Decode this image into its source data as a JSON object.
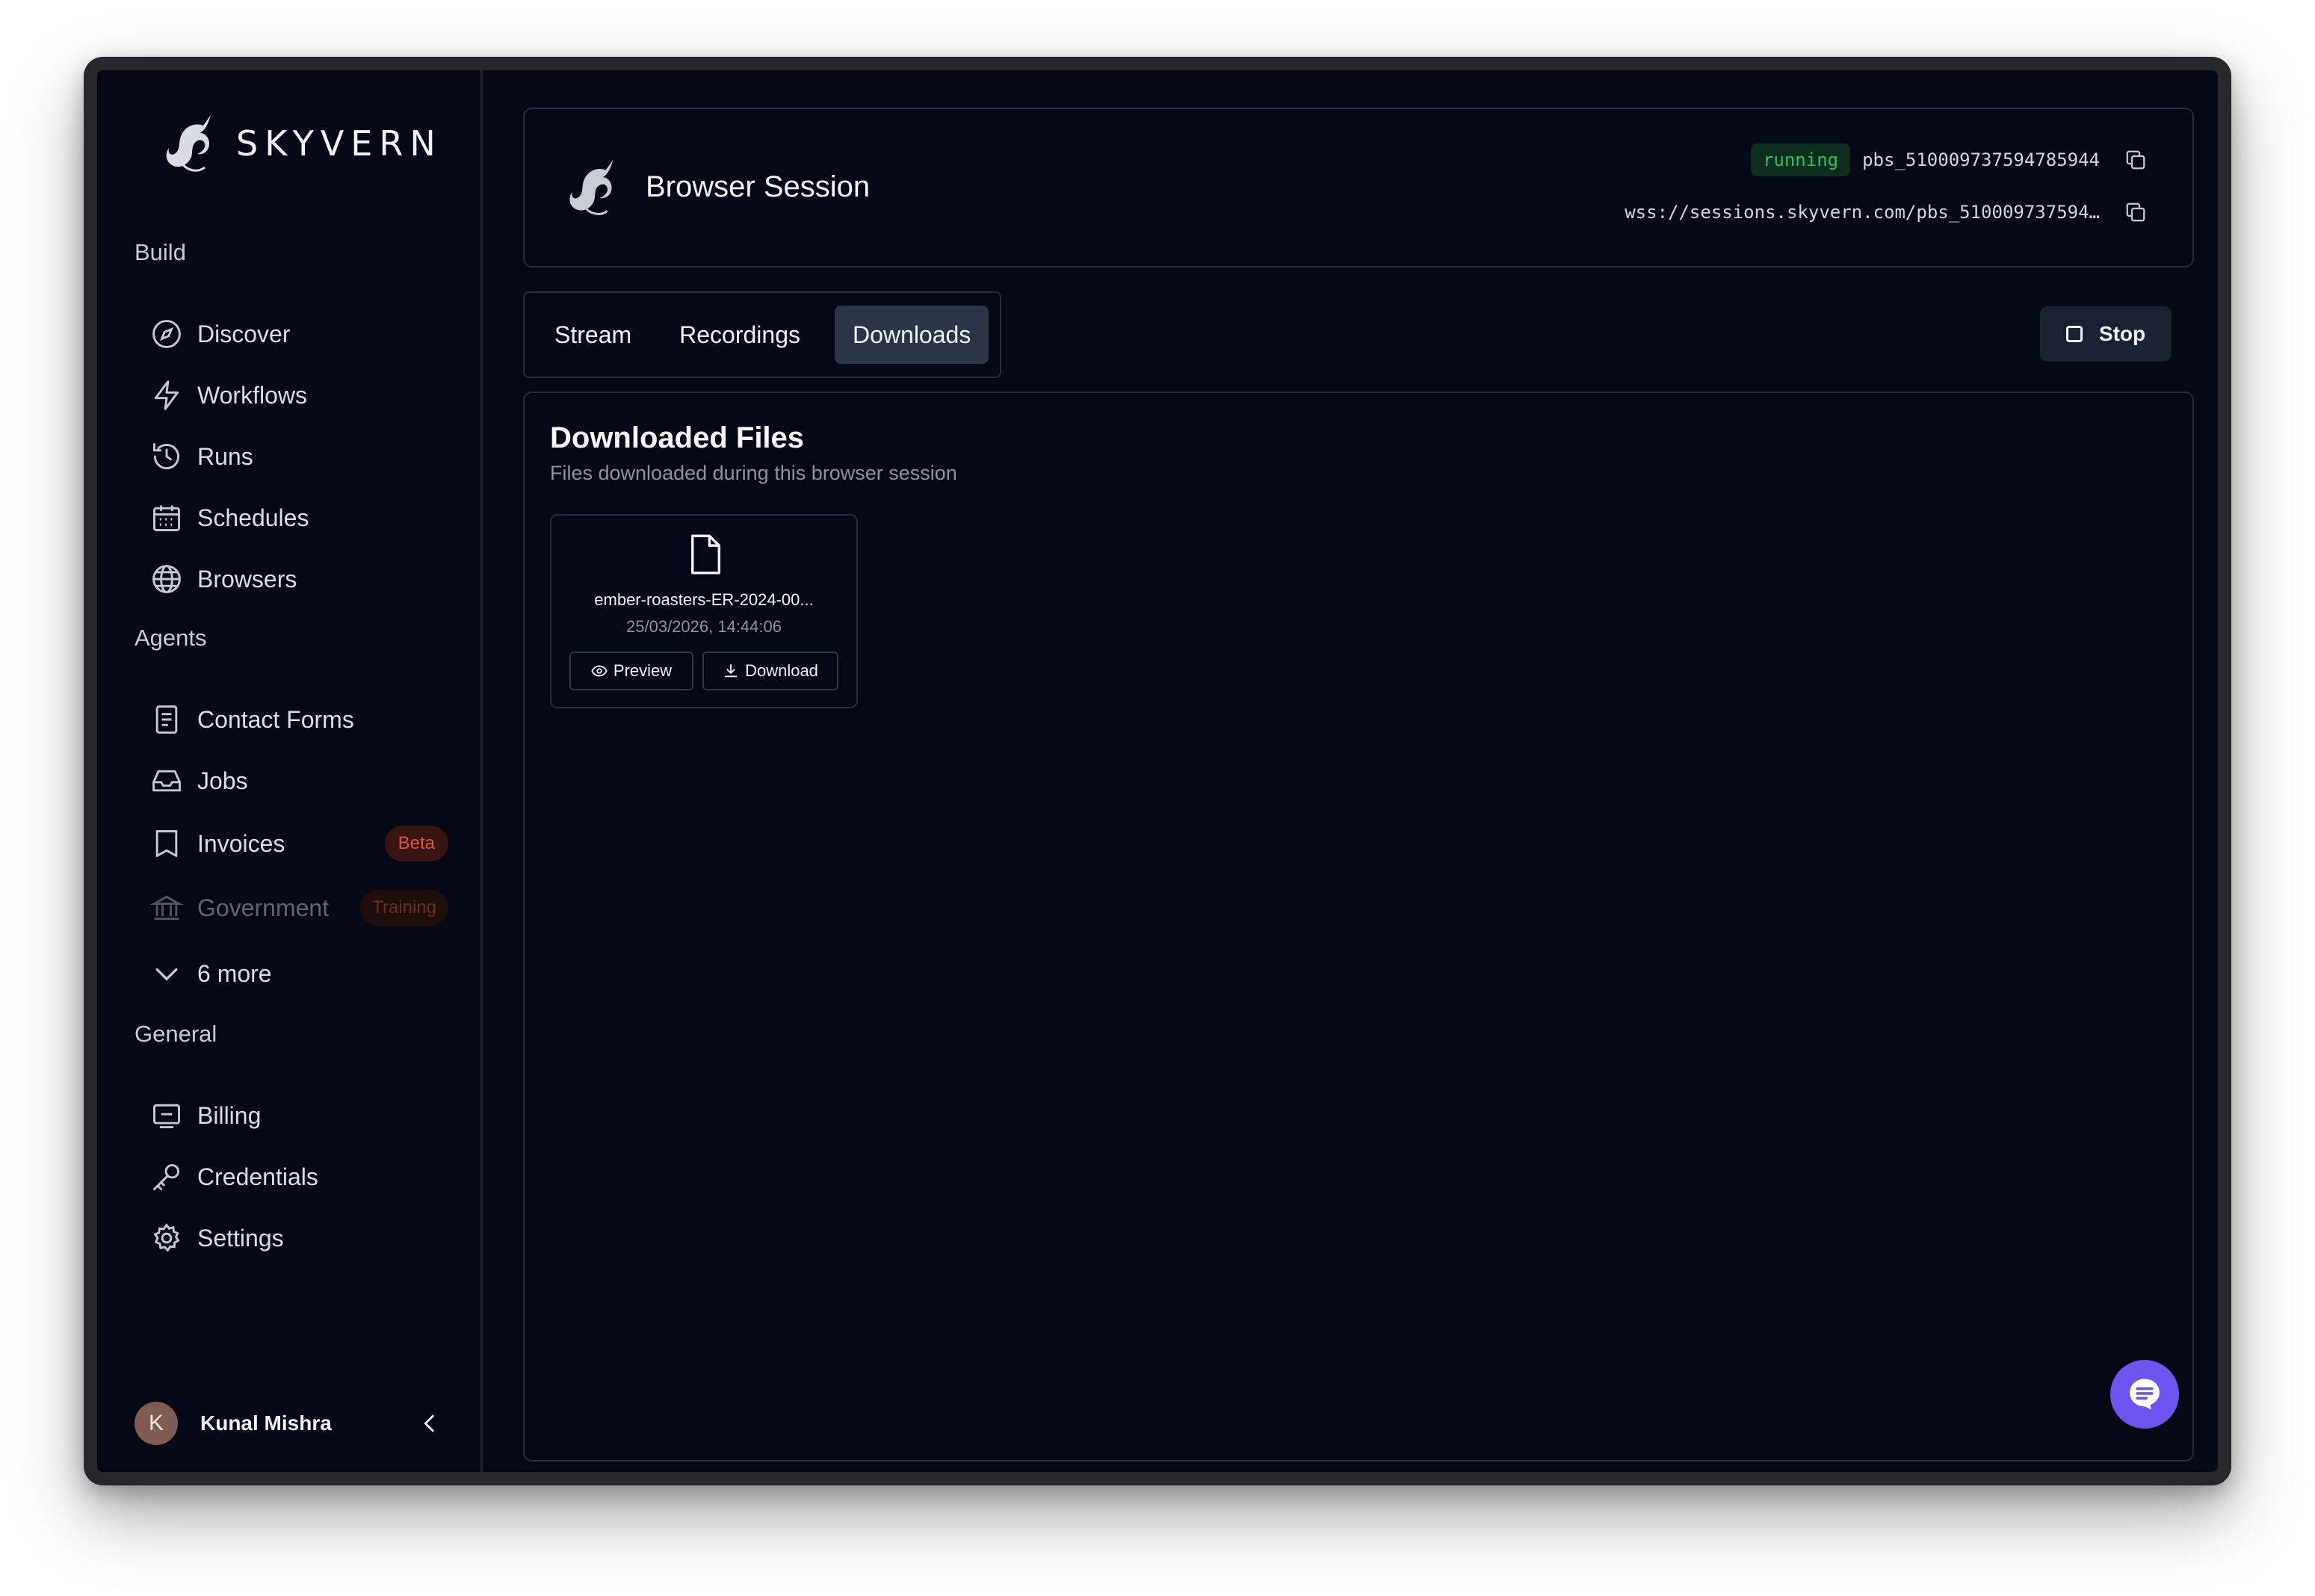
{
  "brand": {
    "name": "SKYVERN",
    "logo_icon": "skyvern-dragon-logo"
  },
  "sidebar": {
    "sections": {
      "build": "Build",
      "agents": "Agents",
      "general": "General"
    },
    "build_items": [
      {
        "label": "Discover",
        "icon": "compass-icon"
      },
      {
        "label": "Workflows",
        "icon": "bolt-icon"
      },
      {
        "label": "Runs",
        "icon": "history-icon"
      },
      {
        "label": "Schedules",
        "icon": "calendar-icon"
      },
      {
        "label": "Browsers",
        "icon": "globe-icon"
      }
    ],
    "agent_items": [
      {
        "label": "Contact Forms",
        "icon": "form-icon"
      },
      {
        "label": "Jobs",
        "icon": "inbox-icon"
      },
      {
        "label": "Invoices",
        "icon": "receipt-icon",
        "badge": "Beta"
      },
      {
        "label": "Government",
        "icon": "bank-icon",
        "badge": "Training"
      },
      {
        "label": "6 more",
        "icon": "chevron-down-icon"
      }
    ],
    "general_items": [
      {
        "label": "Billing",
        "icon": "billing-icon"
      },
      {
        "label": "Credentials",
        "icon": "key-icon"
      },
      {
        "label": "Settings",
        "icon": "gear-icon"
      }
    ],
    "user": {
      "initial": "K",
      "name": "Kunal Mishra"
    }
  },
  "session": {
    "title": "Browser Session",
    "status": "running",
    "session_id": "pbs_510009737594785944",
    "ws_url": "wss://sessions.skyvern.com/pbs_510009737594…"
  },
  "tabs": [
    {
      "label": "Stream",
      "active": false
    },
    {
      "label": "Recordings",
      "active": false
    },
    {
      "label": "Downloads",
      "active": true
    }
  ],
  "stop_label": "Stop",
  "downloads": {
    "title": "Downloaded Files",
    "subtitle": "Files downloaded during this browser session",
    "files": [
      {
        "name": "ember-roasters-ER-2024-00...",
        "date": "25/03/2026, 14:44:06",
        "preview_label": "Preview",
        "download_label": "Download"
      }
    ]
  },
  "colors": {
    "background": "#050916",
    "accent_purple": "#6d53f0",
    "status_green": "#22c55e",
    "beta_orange": "#d9583b"
  }
}
